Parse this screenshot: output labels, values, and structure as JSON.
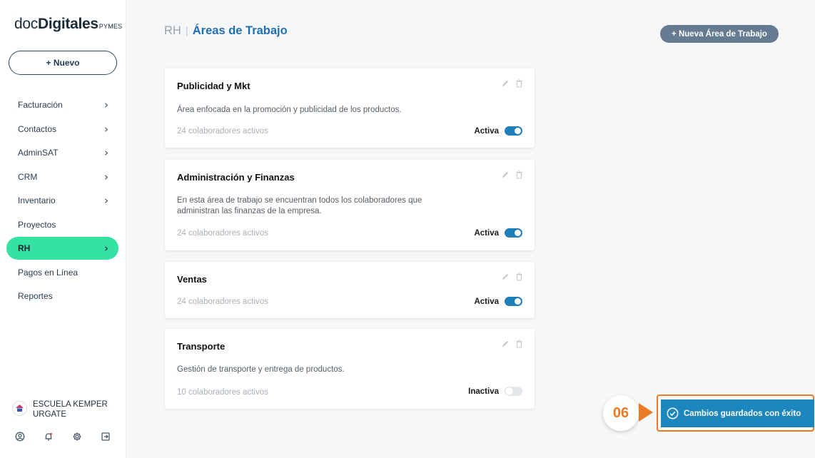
{
  "brand": {
    "part1": "doc",
    "part2": "Digitales",
    "part3": "PYMES"
  },
  "sidebar": {
    "new_button": "+ Nuevo",
    "items": [
      {
        "label": "Facturación",
        "has_chevron": true,
        "active": false
      },
      {
        "label": "Contactos",
        "has_chevron": true,
        "active": false
      },
      {
        "label": "AdminSAT",
        "has_chevron": true,
        "active": false
      },
      {
        "label": "CRM",
        "has_chevron": true,
        "active": false
      },
      {
        "label": "Inventario",
        "has_chevron": true,
        "active": false
      },
      {
        "label": "Proyectos",
        "has_chevron": false,
        "active": false
      },
      {
        "label": "RH",
        "has_chevron": true,
        "active": true
      },
      {
        "label": "Pagos en Línea",
        "has_chevron": false,
        "active": false
      },
      {
        "label": "Reportes",
        "has_chevron": false,
        "active": false
      }
    ],
    "user_name": "ESCUELA KEMPER URGATE",
    "footer_icons": [
      "user-circle-icon",
      "bell-icon",
      "gear-icon",
      "logout-icon"
    ]
  },
  "header": {
    "breadcrumb_root": "RH",
    "breadcrumb_sep": "|",
    "breadcrumb_current": "Áreas de Trabajo",
    "add_button": "+ Nueva Área de Trabajo"
  },
  "areas": [
    {
      "title": "Publicidad y Mkt",
      "description": "Área enfocada en la promoción y publicidad de los productos.",
      "count": "24 colaboradores activos",
      "status": "Activa",
      "active": true
    },
    {
      "title": "Administración y Finanzas",
      "description": "En esta área de trabajo se encuentran todos los colaboradores que administran las finanzas de la empresa.",
      "count": "24 colaboradores activos",
      "status": "Activa",
      "active": true
    },
    {
      "title": "Ventas",
      "description": "",
      "count": "24 colaboradores activos",
      "status": "Activa",
      "active": true
    },
    {
      "title": "Transporte",
      "description": "Gestión de transporte y entrega de productos.",
      "count": "10 colaboradores activos",
      "status": "Inactiva",
      "active": false
    }
  ],
  "annotation": {
    "step": "06"
  },
  "toast": {
    "message": "Cambios guardados con éxito"
  },
  "colors": {
    "accent_green": "#34e3a2",
    "primary_blue": "#1f6fb0",
    "toast_blue": "#1c86bf",
    "annotation_orange": "#ea7a24"
  }
}
